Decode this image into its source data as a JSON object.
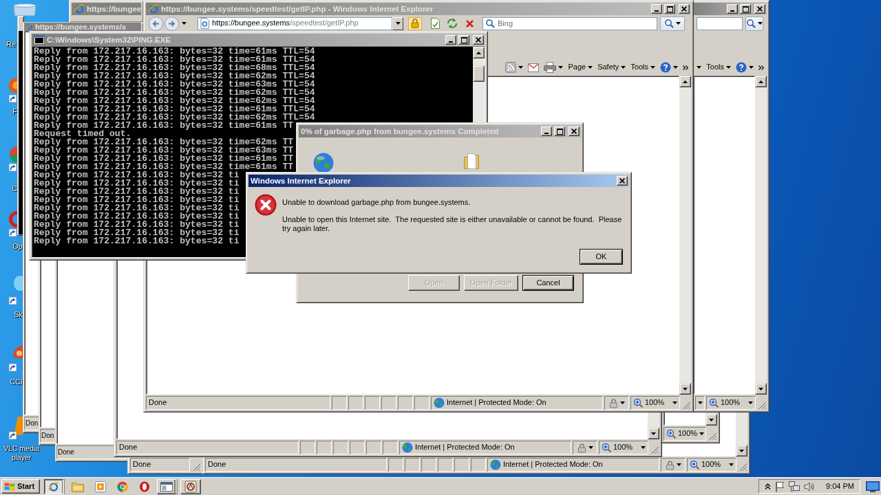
{
  "desktop_icons": [
    {
      "kind": "bin",
      "label": "Re"
    },
    {
      "kind": "fox",
      "label": "F"
    },
    {
      "kind": "ball",
      "label": "C"
    },
    {
      "kind": "ring",
      "label": "Op"
    },
    {
      "kind": "cloud",
      "label": "Sk"
    },
    {
      "kind": "broom",
      "label": "CCl"
    },
    {
      "kind": "cone",
      "label": "VLC media player"
    }
  ],
  "back_windows": [
    {
      "kind": "console"
    },
    {
      "kind": "browser",
      "active": false,
      "title": "https://bungee"
    },
    {
      "kind": "browser",
      "active": false,
      "title": "https://bungee.systems/s",
      "status": "Don"
    },
    {
      "kind": "browser",
      "status": "Don"
    },
    {
      "kind": "browser",
      "status": "Done"
    },
    {
      "kind": "browser",
      "status": "Done"
    },
    {
      "kind": "browser",
      "status": "Done",
      "zone": "Internet | Protected Mode: On",
      "zoom": "100%"
    },
    {
      "kind": "browser",
      "zoom": "100%"
    },
    {
      "kind": "browser",
      "status": "Done",
      "zone": "Internet | Protected Mode: On",
      "zoom": "100%"
    },
    {
      "kind": "browser",
      "active": false,
      "commands": [
        {
          "label": "Tools"
        }
      ],
      "zoom": "100%"
    }
  ],
  "browser_window": {
    "active": false,
    "title": "https://bungee.systems/speedtest/getIP.php - Windows Internet Explorer",
    "address": {
      "host": "https://bungee.systems",
      "path": "/speedtest/getIP.php"
    },
    "search": {
      "placeholder": "Bing"
    },
    "commands": [
      {
        "label": "Page"
      },
      {
        "label": "Safety"
      },
      {
        "label": "Tools"
      }
    ],
    "status": "Done",
    "zone": "Internet | Protected Mode: On",
    "zoom": "100%"
  },
  "console_window": {
    "active": false,
    "title": "C:\\Windows\\System32\\PING.EXE",
    "lines": [
      "Reply from 172.217.16.163: bytes=32 time=61ms TTL=54",
      "Reply from 172.217.16.163: bytes=32 time=61ms TTL=54",
      "Reply from 172.217.16.163: bytes=32 time=68ms TTL=54",
      "Reply from 172.217.16.163: bytes=32 time=62ms TTL=54",
      "Reply from 172.217.16.163: bytes=32 time=63ms TTL=54",
      "Reply from 172.217.16.163: bytes=32 time=62ms TTL=54",
      "Reply from 172.217.16.163: bytes=32 time=62ms TTL=54",
      "Reply from 172.217.16.163: bytes=32 time=61ms TTL=54",
      "Reply from 172.217.16.163: bytes=32 time=62ms TTL=54",
      "Reply from 172.217.16.163: bytes=32 time=61ms TT",
      "Request timed out.",
      "Reply from 172.217.16.163: bytes=32 time=62ms TT",
      "Reply from 172.217.16.163: bytes=32 time=63ms TT",
      "Reply from 172.217.16.163: bytes=32 time=61ms TT",
      "Reply from 172.217.16.163: bytes=32 time=61ms TT",
      "Reply from 172.217.16.163: bytes=32 ti",
      "Reply from 172.217.16.163: bytes=32 ti",
      "Reply from 172.217.16.163: bytes=32 ti",
      "Reply from 172.217.16.163: bytes=32 ti",
      "Reply from 172.217.16.163: bytes=32 ti",
      "Reply from 172.217.16.163: bytes=32 ti",
      "Reply from 172.217.16.163: bytes=32 ti",
      "Reply from 172.217.16.163: bytes=32 ti",
      "Reply from 172.217.16.163: bytes=32 ti"
    ]
  },
  "download_dialog": {
    "active": false,
    "title": "0% of garbage.php from bungee.systems Completed",
    "buttons": [
      {
        "label": "Open",
        "disabled": true,
        "default": false
      },
      {
        "label": "Open Folder",
        "disabled": true,
        "default": false
      },
      {
        "label": "Cancel",
        "disabled": false,
        "default": true
      }
    ]
  },
  "error_dialog": {
    "active": true,
    "title": "Windows Internet Explorer",
    "message": "Unable to download garbage.php from bungee.systems.",
    "detail": "Unable to open this Internet site.  The requested site is either unavailable or cannot be found.  Please try again later.",
    "buttons": [
      {
        "label": "OK",
        "default": true
      }
    ]
  },
  "taskbar": {
    "start": "Start",
    "apps": [
      {
        "kind": "browser",
        "running": true,
        "selected": true,
        "stacked": true
      },
      {
        "kind": "folder",
        "running": false,
        "selected": false
      },
      {
        "kind": "player",
        "running": false,
        "selected": false
      },
      {
        "kind": "ball",
        "running": false,
        "selected": false
      },
      {
        "kind": "ring",
        "running": false,
        "selected": false
      },
      {
        "kind": "window",
        "running": true,
        "selected": false,
        "stacked": true
      },
      {
        "kind": "app",
        "running": true,
        "selected": false,
        "stacked": false
      }
    ],
    "clock": "9:04 PM"
  }
}
